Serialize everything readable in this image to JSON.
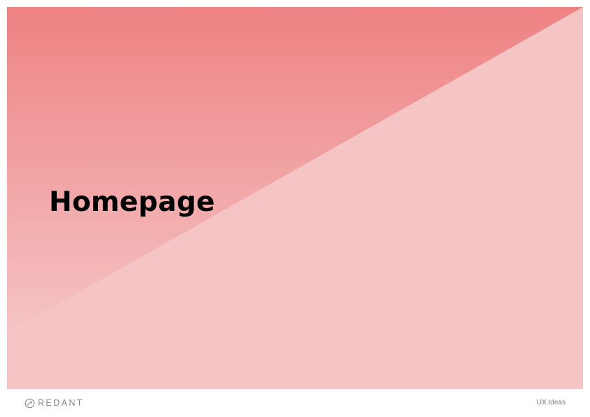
{
  "slide": {
    "title": "Homepage",
    "colors": {
      "background_light": "#f5c4c5",
      "gradient_top": "#ee8283",
      "gradient_bottom": "#f5c4c5",
      "title_text": "#000000"
    }
  },
  "footer": {
    "logo": {
      "icon": "redant-logo-icon",
      "wordmark": "REDANT"
    },
    "label": "UX Ideas"
  }
}
